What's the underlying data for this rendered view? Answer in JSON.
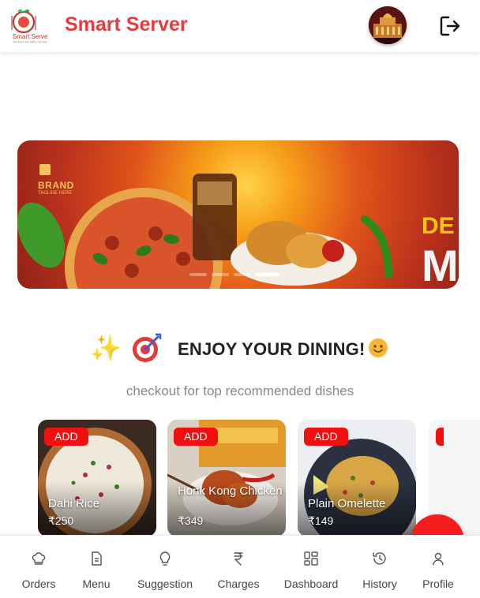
{
  "header": {
    "logo_text": "Smart Serve",
    "logo_tagline": "Your Food, Your Table, Your Way",
    "title": "Smart Server",
    "avatar_icon": "restaurant-avatar",
    "logout_icon": "logout-icon"
  },
  "banner": {
    "brand": "BRAND",
    "tagline": "TAGLINE HERE",
    "slides": 4,
    "active_slide": 4
  },
  "section": {
    "title": "ENJOY YOUR DINING!",
    "subtitle": "checkout for top recommended dishes"
  },
  "dishes": [
    {
      "name": "Dahi Rice",
      "price": "₹250",
      "add_label": "ADD"
    },
    {
      "name": "Honk Kong Chicken",
      "price": "₹349",
      "add_label": "ADD"
    },
    {
      "name": "Plain Omelette",
      "price": "₹149",
      "add_label": "ADD"
    }
  ],
  "nav": [
    {
      "label": "Orders",
      "icon": "chef-hat-icon"
    },
    {
      "label": "Menu",
      "icon": "document-icon"
    },
    {
      "label": "Suggestion",
      "icon": "lightbulb-icon"
    },
    {
      "label": "Charges",
      "icon": "rupee-icon"
    },
    {
      "label": "Dashboard",
      "icon": "dashboard-icon"
    },
    {
      "label": "History",
      "icon": "history-icon"
    },
    {
      "label": "Profile",
      "icon": "user-icon"
    }
  ],
  "colors": {
    "brand_red": "#ea3b3b",
    "button_red": "#f11010",
    "fab_red": "#f51d1d"
  }
}
